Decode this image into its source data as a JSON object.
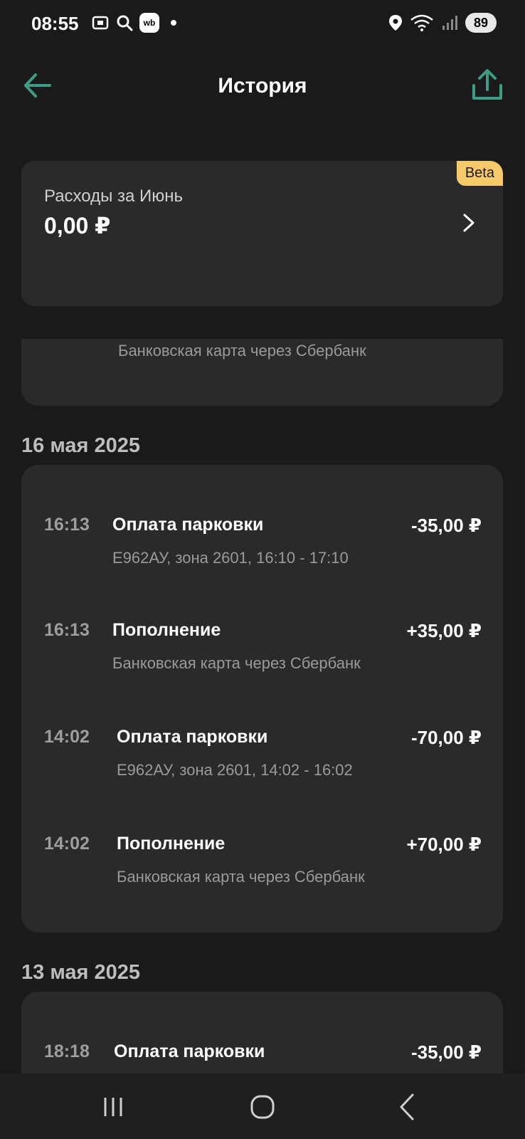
{
  "status_bar": {
    "time": "08:55",
    "wb_label": "wb",
    "battery": "89"
  },
  "header": {
    "title": "История"
  },
  "expenses": {
    "badge": "Beta",
    "label": "Расходы за Июнь",
    "value": "0,00 ₽"
  },
  "partial_item": {
    "subtitle": "Банковская карта через Сбербанк"
  },
  "groups": [
    {
      "date": "16 мая 2025",
      "transactions": [
        {
          "time": "16:13",
          "title": "Оплата парковки",
          "amount": "-35,00 ₽",
          "subtitle": "Е962АУ, зона 2601, 16:10 - 17:10"
        },
        {
          "time": "16:13",
          "title": "Пополнение",
          "amount": "+35,00 ₽",
          "subtitle": "Банковская карта через Сбербанк"
        },
        {
          "time": "14:02",
          "title": "Оплата парковки",
          "amount": "-70,00 ₽",
          "subtitle": "Е962АУ, зона 2601, 14:02 - 16:02"
        },
        {
          "time": "14:02",
          "title": "Пополнение",
          "amount": "+70,00 ₽",
          "subtitle": "Банковская карта через Сбербанк"
        }
      ]
    },
    {
      "date": "13 мая 2025",
      "transactions": [
        {
          "time": "18:18",
          "title": "Оплата парковки",
          "amount": "-35,00 ₽",
          "subtitle": ""
        }
      ]
    }
  ],
  "colors": {
    "background": "#1a1a1a",
    "card": "#2a2a2a",
    "accent": "#3f9b86",
    "beta": "#f6c96a"
  }
}
